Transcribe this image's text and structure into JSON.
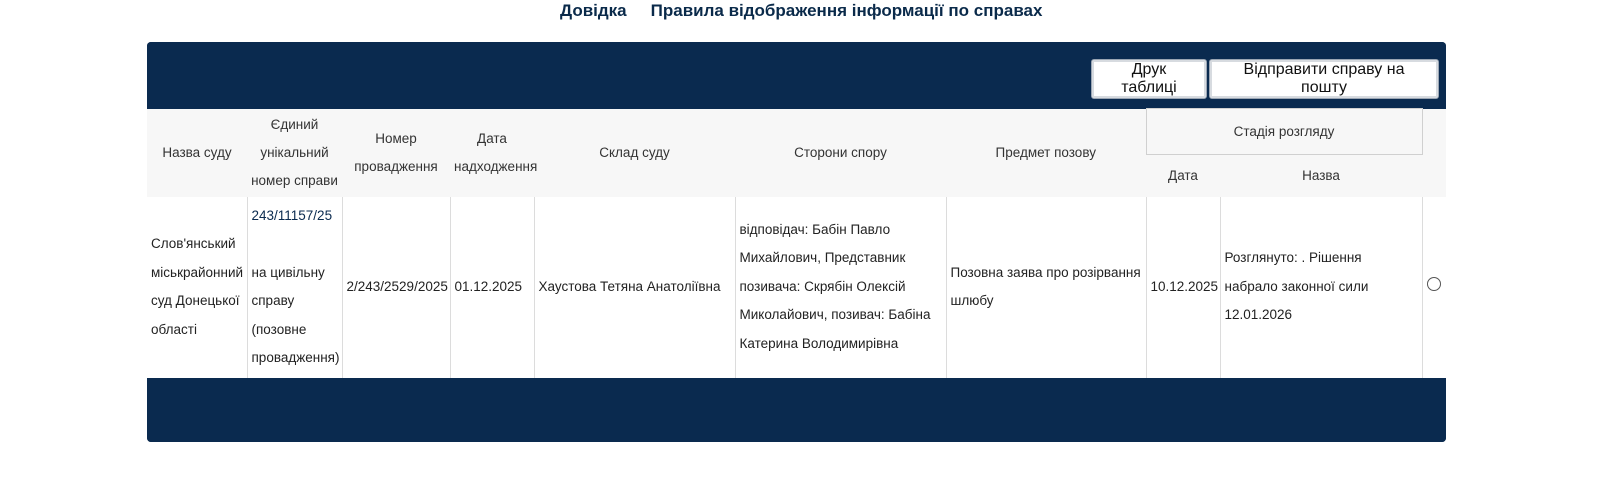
{
  "top_links": {
    "help": "Довідка",
    "rules": "Правила відображення інформації по справах"
  },
  "toolbar": {
    "print_label": "Друк таблиці",
    "mail_label": "Відправити справу на пошту"
  },
  "table": {
    "headers": {
      "court": "Назва суду",
      "unique_number": "Єдиний унікальний номер справи",
      "proceeding_number": "Номер провадження",
      "received_date": "Дата надходження",
      "panel": "Склад суду",
      "parties": "Сторони спору",
      "subject": "Предмет позову",
      "stage": "Стадія розгляду",
      "stage_date": "Дата",
      "stage_name": "Назва"
    },
    "rows": [
      {
        "court": "Слов'янський міськрайонний суд Донецької області",
        "case_number": "243/11157/25",
        "case_type": "на цивільну справу (позовне провадження)",
        "proceeding_number": "2/243/2529/2025",
        "received_date": "01.12.2025",
        "panel": "Хаустова Тетяна Анатоліївна",
        "parties": "відповідач: Бабін Павло Михайлович, Представник позивача: Скрябін Олексій Миколайович, позивач: Бабіна Катерина Володимирівна",
        "subject": "Позовна заява про розірвання шлюбу",
        "stage_date": "10.12.2025",
        "stage_name": "Розглянуто: . Рішення набрало законної сили 12.01.2026"
      }
    ]
  }
}
